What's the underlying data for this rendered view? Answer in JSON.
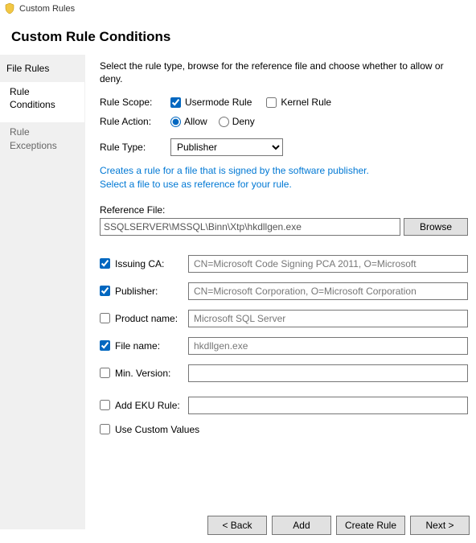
{
  "window_title": "Custom Rules",
  "page_heading": "Custom Rule Conditions",
  "sidebar": {
    "heading": "File Rules",
    "items": [
      {
        "label": "Rule\nConditions",
        "active": true
      },
      {
        "label": "Rule\nExceptions",
        "active": false
      }
    ]
  },
  "instruction": "Select the rule type, browse for the reference file and choose whether to allow or deny.",
  "scope": {
    "label": "Rule Scope:",
    "usermode_label": "Usermode Rule",
    "usermode_checked": true,
    "kernel_label": "Kernel Rule",
    "kernel_checked": false
  },
  "action": {
    "label": "Rule Action:",
    "allow_label": "Allow",
    "deny_label": "Deny",
    "selected": "allow"
  },
  "type": {
    "label": "Rule Type:",
    "options": [
      "Publisher"
    ],
    "selected": "Publisher"
  },
  "hint": "Creates a rule for a file that is signed by the software publisher.\nSelect a file to use as reference for your rule.",
  "reference": {
    "label": "Reference File:",
    "value": "SSQLSERVER\\MSSQL\\Binn\\Xtp\\hkdllgen.exe",
    "browse_label": "Browse"
  },
  "options": {
    "issuing_ca": {
      "label": "Issuing CA:",
      "checked": true,
      "value": "CN=Microsoft Code Signing PCA 2011, O=Microsoft"
    },
    "publisher": {
      "label": "Publisher:",
      "checked": true,
      "value": "CN=Microsoft Corporation, O=Microsoft Corporation"
    },
    "product_name": {
      "label": "Product name:",
      "checked": false,
      "value": "Microsoft SQL Server"
    },
    "file_name": {
      "label": "File name:",
      "checked": true,
      "value": "hkdllgen.exe"
    },
    "min_version": {
      "label": "Min. Version:",
      "checked": false,
      "value": ""
    },
    "add_eku": {
      "label": "Add EKU Rule:",
      "checked": false,
      "value": ""
    },
    "use_custom": {
      "label": "Use Custom Values",
      "checked": false
    }
  },
  "buttons": {
    "back": "< Back",
    "add": "Add",
    "create": "Create Rule",
    "next": "Next >"
  }
}
